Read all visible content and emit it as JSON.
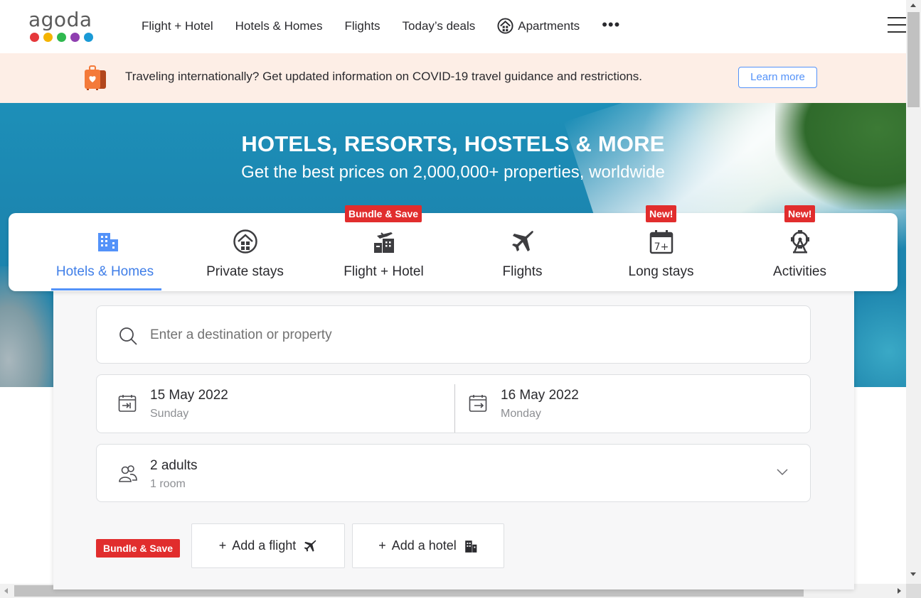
{
  "header": {
    "logo_text": "agoda",
    "logo_dot_colors": [
      "#e5383b",
      "#f4b400",
      "#2fb84f",
      "#8f3fb0",
      "#1a9ad6"
    ],
    "nav": [
      {
        "label": "Flight + Hotel"
      },
      {
        "label": "Hotels & Homes"
      },
      {
        "label": "Flights"
      },
      {
        "label": "Today’s deals"
      },
      {
        "label": "Apartments",
        "icon": "house-icon"
      }
    ],
    "more_label": "•••"
  },
  "banner": {
    "text": "Traveling internationally? Get updated information on COVID-19 travel guidance and restrictions.",
    "button": "Learn more",
    "icon": "luggage-heart-icon"
  },
  "hero": {
    "title": "HOTELS, RESORTS, HOSTELS & MORE",
    "subtitle": "Get the best prices on 2,000,000+ properties, worldwide"
  },
  "tabs": [
    {
      "label": "Hotels & Homes",
      "icon": "hotel-building-icon",
      "active": true
    },
    {
      "label": "Private stays",
      "icon": "house-icon"
    },
    {
      "label": "Flight + Hotel",
      "icon": "plane-hotel-icon",
      "badge": "Bundle & Save"
    },
    {
      "label": "Flights",
      "icon": "airplane-icon"
    },
    {
      "label": "Long stays",
      "icon": "calendar-7plus-icon",
      "badge": "New!"
    },
    {
      "label": "Activities",
      "icon": "ferris-wheel-icon",
      "badge": "New!"
    }
  ],
  "search": {
    "destination_placeholder": "Enter a destination or property",
    "checkin": {
      "date": "15 May 2022",
      "day": "Sunday"
    },
    "checkout": {
      "date": "16 May 2022",
      "day": "Monday"
    },
    "occupancy": {
      "guests": "2 adults",
      "rooms": "1 room"
    },
    "bundle_badge": "Bundle & Save",
    "add_flight": "Add a flight",
    "add_hotel": "Add a hotel",
    "plus": "+"
  },
  "colors": {
    "accent": "#5392f9",
    "badge_red": "#e12d2d",
    "banner_bg": "#fdeee6"
  }
}
